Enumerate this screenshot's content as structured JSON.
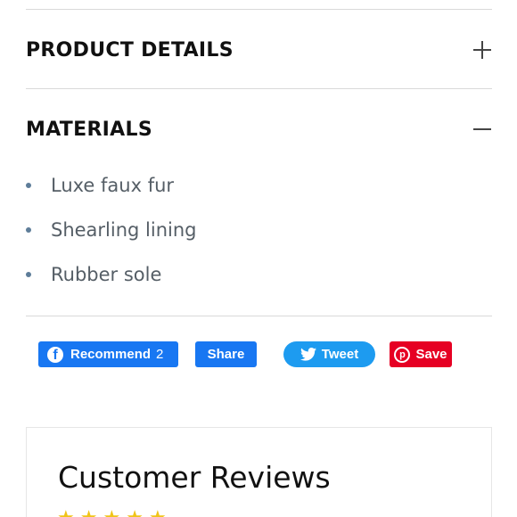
{
  "accordion": {
    "product_details": {
      "title": "PRODUCT DETAILS",
      "icon": "plus-icon"
    },
    "materials": {
      "title": "MATERIALS",
      "icon": "minus-icon",
      "items": [
        "Luxe faux fur",
        "Shearling lining",
        "Rubber sole"
      ]
    }
  },
  "share": {
    "recommend_label": "Recommend",
    "recommend_count": "2",
    "share_label": "Share",
    "tweet_label": "Tweet",
    "save_label": "Save",
    "colors": {
      "facebook": "#1877f2",
      "twitter": "#1d9bf0",
      "pinterest": "#e60023"
    }
  },
  "reviews": {
    "title": "Customer Reviews",
    "star_color": "#f0c419"
  }
}
